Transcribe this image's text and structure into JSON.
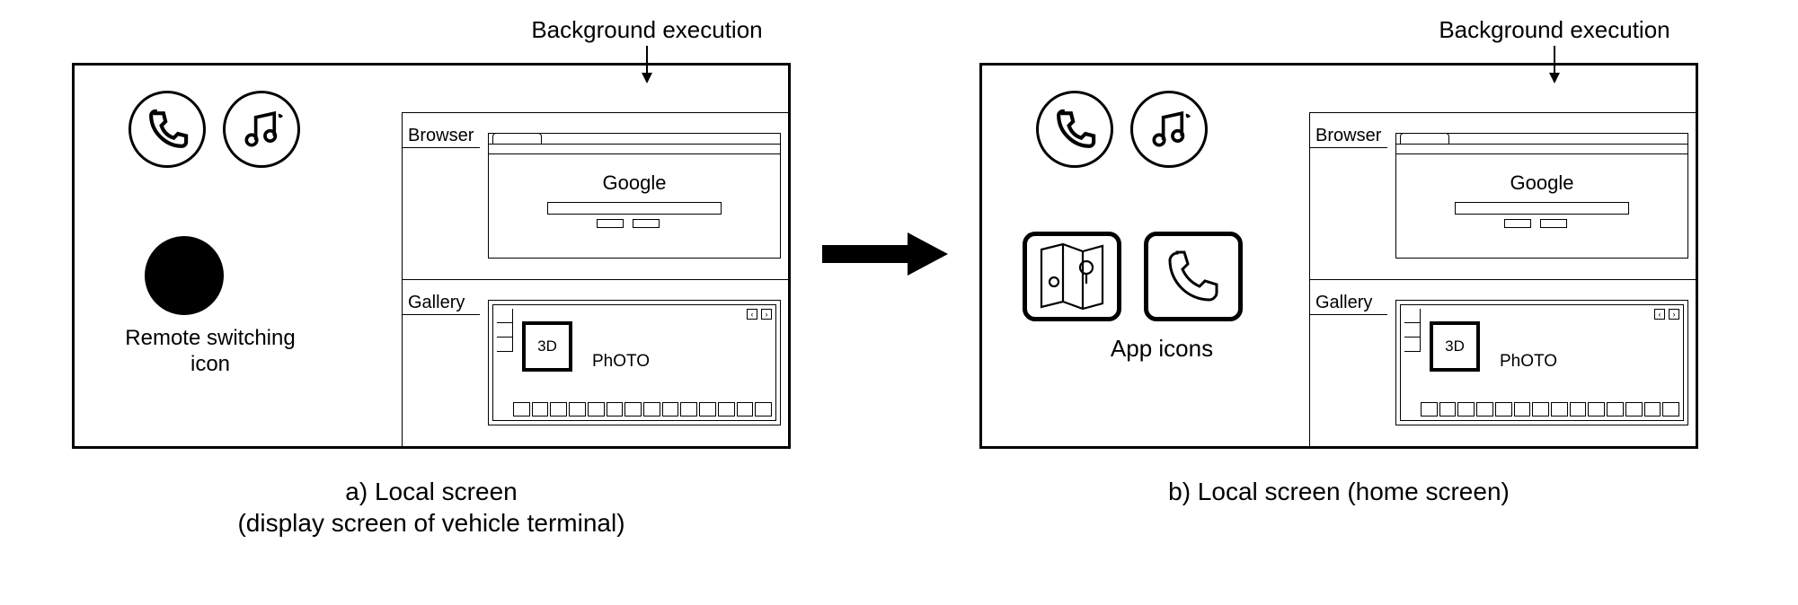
{
  "bg_exec_label": "Background execution",
  "browser_label": "Browser",
  "browser_search_text": "Google",
  "gallery_label": "Gallery",
  "gallery_3d_label": "3D",
  "gallery_photo_label": "PhOTO",
  "panel_a": {
    "caption_line1": "a) Local screen",
    "caption_line2": "(display screen of vehicle terminal)",
    "remote_label_line1": "Remote switching",
    "remote_label_line2": "icon"
  },
  "panel_b": {
    "caption_line1": "b) Local screen (home screen)",
    "app_icons_label": "App icons"
  },
  "icons": {
    "phone": "phone-icon",
    "music": "music-icon",
    "maps": "maps-icon",
    "call_app": "call-app-icon",
    "remote_switch": "remote-switch-dot-icon",
    "arrow": "transition-arrow-icon"
  }
}
